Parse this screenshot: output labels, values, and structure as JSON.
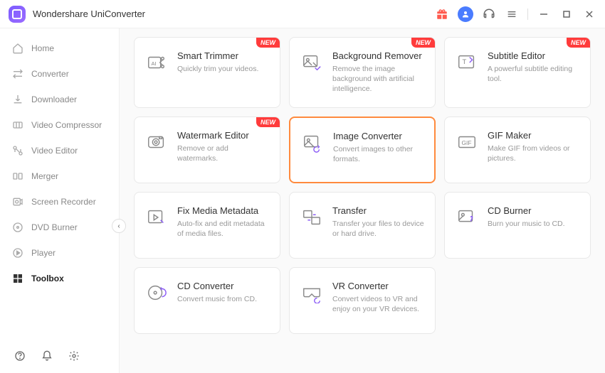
{
  "app": {
    "title": "Wondershare UniConverter"
  },
  "titlebar_icons": {
    "gift": "gift",
    "user": "user",
    "support": "support",
    "menu": "menu",
    "min": "minimize",
    "max": "maximize",
    "close": "close"
  },
  "sidebar": {
    "items": [
      {
        "label": "Home",
        "icon": "home"
      },
      {
        "label": "Converter",
        "icon": "converter"
      },
      {
        "label": "Downloader",
        "icon": "downloader"
      },
      {
        "label": "Video Compressor",
        "icon": "compressor"
      },
      {
        "label": "Video Editor",
        "icon": "editor"
      },
      {
        "label": "Merger",
        "icon": "merger"
      },
      {
        "label": "Screen Recorder",
        "icon": "recorder"
      },
      {
        "label": "DVD Burner",
        "icon": "dvd"
      },
      {
        "label": "Player",
        "icon": "player"
      },
      {
        "label": "Toolbox",
        "icon": "toolbox",
        "active": true
      }
    ],
    "collapse": "‹"
  },
  "cards": [
    {
      "title": "Smart Trimmer",
      "desc": "Quickly trim your videos.",
      "new": true,
      "icon": "trimmer"
    },
    {
      "title": "Background Remover",
      "desc": "Remove the image background with artificial intelligence.",
      "new": true,
      "icon": "bgremove"
    },
    {
      "title": "Subtitle Editor",
      "desc": "A powerful subtitle editing tool.",
      "new": true,
      "icon": "subtitle"
    },
    {
      "title": "Watermark Editor",
      "desc": "Remove or add watermarks.",
      "new": true,
      "icon": "watermark"
    },
    {
      "title": "Image Converter",
      "desc": "Convert images to other formats.",
      "new": false,
      "icon": "imageconv",
      "highlight": true
    },
    {
      "title": "GIF Maker",
      "desc": "Make GIF from videos or pictures.",
      "new": false,
      "icon": "gif"
    },
    {
      "title": "Fix Media Metadata",
      "desc": "Auto-fix and edit metadata of media files.",
      "new": false,
      "icon": "metadata"
    },
    {
      "title": "Transfer",
      "desc": "Transfer your files to device or hard drive.",
      "new": false,
      "icon": "transfer"
    },
    {
      "title": "CD Burner",
      "desc": "Burn your music to CD.",
      "new": false,
      "icon": "cdburn"
    },
    {
      "title": "CD Converter",
      "desc": "Convert music from CD.",
      "new": false,
      "icon": "cdconv"
    },
    {
      "title": "VR Converter",
      "desc": "Convert videos to VR and enjoy on your VR devices.",
      "new": false,
      "icon": "vr"
    }
  ],
  "badge_label": "NEW"
}
